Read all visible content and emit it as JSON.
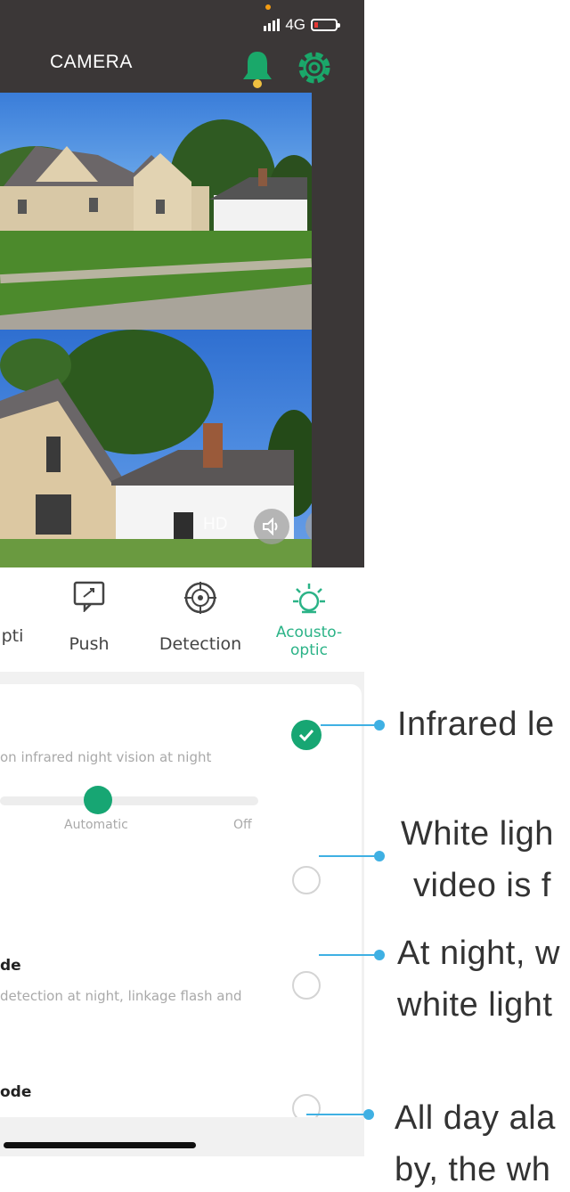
{
  "status_bar": {
    "network": "4G"
  },
  "header": {
    "title": "CAMERA",
    "bell_icon": "bell-icon",
    "settings_icon": "gear-icon",
    "accent_color": "#1aa86a"
  },
  "video": {
    "hd_label": "HD",
    "volume_icon": "speaker-icon",
    "fullscreen_icon": "fullscreen-icon"
  },
  "tabs": [
    {
      "label": "pti",
      "icon": "partial-icon"
    },
    {
      "label": "Push",
      "icon": "chat-icon"
    },
    {
      "label": "Detection",
      "icon": "target-icon"
    },
    {
      "label": "Acousto-",
      "label2": "optic",
      "icon": "light-bulb-icon",
      "active": true
    }
  ],
  "settings": {
    "infrared_desc": "on infrared night vision at night",
    "slider_label": "Automatic",
    "slider_end": "Off",
    "slider_level": "Automatic",
    "item3_title": "de",
    "item3_desc": "detection at night, linkage flash and",
    "item4_title": "ode"
  },
  "annotations": [
    {
      "line1": "Infrared le"
    },
    {
      "line1": "White ligh",
      "line2": "video is f"
    },
    {
      "line1": "At night, w",
      "line2": "white light"
    },
    {
      "line1": "All day ala",
      "line2": "by, the wh"
    }
  ]
}
